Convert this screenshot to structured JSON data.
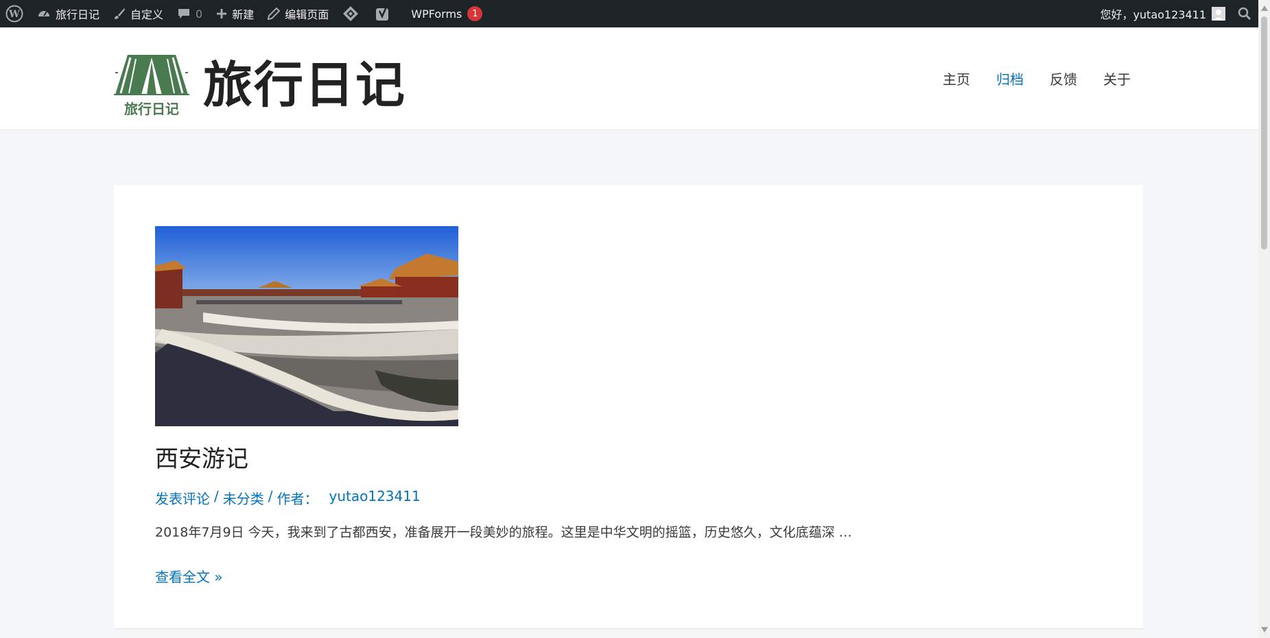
{
  "adminbar": {
    "site_name": "旅行日记",
    "customize": "自定义",
    "comments_count": "0",
    "new_label": "新建",
    "edit_page": "编辑页面",
    "wpforms": "WPForms",
    "wpforms_badge": "1",
    "greeting": "您好，yutao123411"
  },
  "header": {
    "site_title": "旅行日记",
    "logo_text": "旅行日记",
    "nav": [
      "主页",
      "归档",
      "反馈",
      "关于"
    ],
    "active_nav": "归档"
  },
  "post": {
    "title": "西安游记",
    "meta_comment": "发表评论",
    "meta_category": "未分类",
    "meta_author_label": "作者：",
    "meta_author": "yutao123411",
    "excerpt": "2018年7月9日 今天，我来到了古都西安，准备展开一段美妙的旅程。这里是中华文明的摇篮，历史悠久，文化底蕴深 …",
    "read_more": "查看全文 »"
  },
  "colors": {
    "adminbar_bg": "#1d2327",
    "link": "#0274be",
    "badge": "#d63638",
    "logo_green": "#4a7a4f"
  }
}
